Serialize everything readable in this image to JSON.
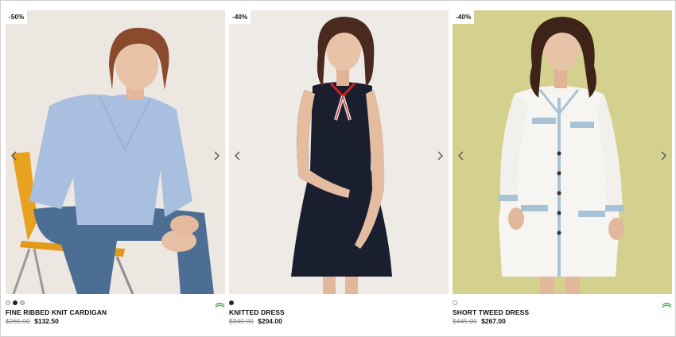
{
  "products": [
    {
      "badge": "-50%",
      "name": "FINE RIBBED KNIT CARDIGAN",
      "old_price": "$265.00",
      "new_price": "$132.50",
      "swatches": [
        "#e6e6e6",
        "#1d2741",
        "#bfd2ea"
      ],
      "eco_icon": "eco-responsible-icon",
      "bg_color": "#e9e4dd"
    },
    {
      "badge": "-40%",
      "name": "KNITTED DRESS",
      "old_price": "$340.00",
      "new_price": "$204.00",
      "swatches": [
        "#1d2741"
      ],
      "eco_icon": null,
      "bg_color": "#ede9e4"
    },
    {
      "badge": "-40%",
      "name": "SHORT TWEED DRESS",
      "old_price": "$445.00",
      "new_price": "$267.00",
      "swatches": [
        "#ffffff"
      ],
      "eco_icon": "eco-responsible-icon",
      "bg_color": "#d5d392"
    }
  ],
  "icons": {
    "prev": "chevron-left-icon",
    "next": "chevron-right-icon"
  }
}
